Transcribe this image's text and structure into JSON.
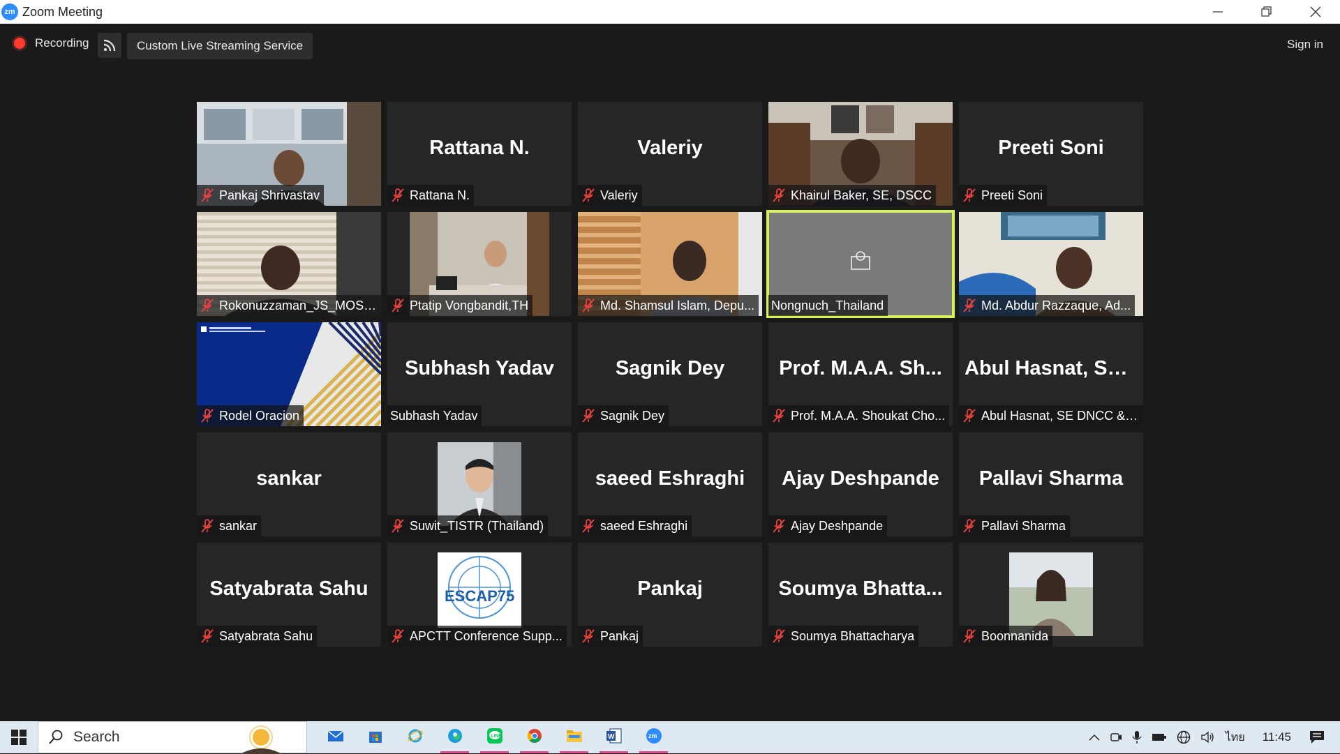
{
  "window": {
    "title": "Zoom Meeting",
    "logo_text": "zm"
  },
  "topbar": {
    "recording_label": "Recording",
    "streaming_label": "Custom Live Streaming Service",
    "sign_in_label": "Sign in"
  },
  "participants": [
    {
      "label": "Pankaj Shrivastav",
      "big": "",
      "muted": true,
      "video": "office-man"
    },
    {
      "label": "Rattana N.",
      "big": "Rattana N.",
      "muted": true,
      "video": ""
    },
    {
      "label": "Valeriy",
      "big": "Valeriy",
      "muted": true,
      "video": ""
    },
    {
      "label": "Khairul Baker, SE, DSCC",
      "big": "",
      "muted": true,
      "video": "office-man-2"
    },
    {
      "label": "Preeti Soni",
      "big": "Preeti Soni",
      "muted": true,
      "video": ""
    },
    {
      "label": "Rokonuzzaman_JS_MOST...",
      "big": "",
      "muted": true,
      "video": "blinds-man"
    },
    {
      "label": "Ptatip Vongbandit,TH",
      "big": "",
      "muted": true,
      "video": "office-room"
    },
    {
      "label": "Md. Shamsul Islam, Depu...",
      "big": "",
      "muted": true,
      "video": "desk-man"
    },
    {
      "label": "Nongnuch_Thailand",
      "big": "",
      "muted": false,
      "video": "placeholder",
      "active": true
    },
    {
      "label": "Md. Abdur Razzaque, Ad...",
      "big": "",
      "muted": true,
      "video": "office-man-3"
    },
    {
      "label": "Rodel Oracion",
      "big": "",
      "muted": true,
      "video": "slide"
    },
    {
      "label": "Subhash Yadav",
      "big": "Subhash Yadav",
      "muted": false,
      "video": ""
    },
    {
      "label": "Sagnik Dey",
      "big": "Sagnik Dey",
      "muted": true,
      "video": ""
    },
    {
      "label": "Prof. M.A.A. Shoukat Cho...",
      "big": "Prof. M.A.A. Sh...",
      "muted": true,
      "video": ""
    },
    {
      "label": "Abul Hasnat, SE DNCC & ...",
      "big": "Abul Hasnat, SE...",
      "muted": true,
      "video": ""
    },
    {
      "label": "sankar",
      "big": "sankar",
      "muted": true,
      "video": ""
    },
    {
      "label": "Suwit_TISTR (Thailand)",
      "big": "",
      "muted": true,
      "video": "photo-man"
    },
    {
      "label": "saeed Eshraghi",
      "big": "saeed Eshraghi",
      "muted": true,
      "video": ""
    },
    {
      "label": "Ajay Deshpande",
      "big": "Ajay Deshpande",
      "muted": true,
      "video": ""
    },
    {
      "label": "Pallavi Sharma",
      "big": "Pallavi Sharma",
      "muted": true,
      "video": ""
    },
    {
      "label": "Satyabrata Sahu",
      "big": "Satyabrata Sahu",
      "muted": true,
      "video": ""
    },
    {
      "label": "APCTT Conference Supp...",
      "big": "",
      "muted": true,
      "video": "escap",
      "logo_text": "ESCAP75"
    },
    {
      "label": "Pankaj",
      "big": "Pankaj",
      "muted": true,
      "video": ""
    },
    {
      "label": "Soumya Bhattacharya",
      "big": "Soumya  Bhatta...",
      "muted": true,
      "video": ""
    },
    {
      "label": "Boonnanida",
      "big": "",
      "muted": true,
      "video": "photo-woman"
    }
  ],
  "taskbar": {
    "search_placeholder": "Search",
    "language": "ไทย",
    "clock": "11:45",
    "apps": [
      "mail-icon",
      "store-icon",
      "ie-icon",
      "edge-icon",
      "line-icon",
      "chrome-icon",
      "explorer-icon",
      "word-icon",
      "zoom-icon"
    ]
  },
  "colors": {
    "active_speaker": "#d6f25b",
    "mute_red": "#e8423f",
    "accent": "#2d8cff"
  }
}
